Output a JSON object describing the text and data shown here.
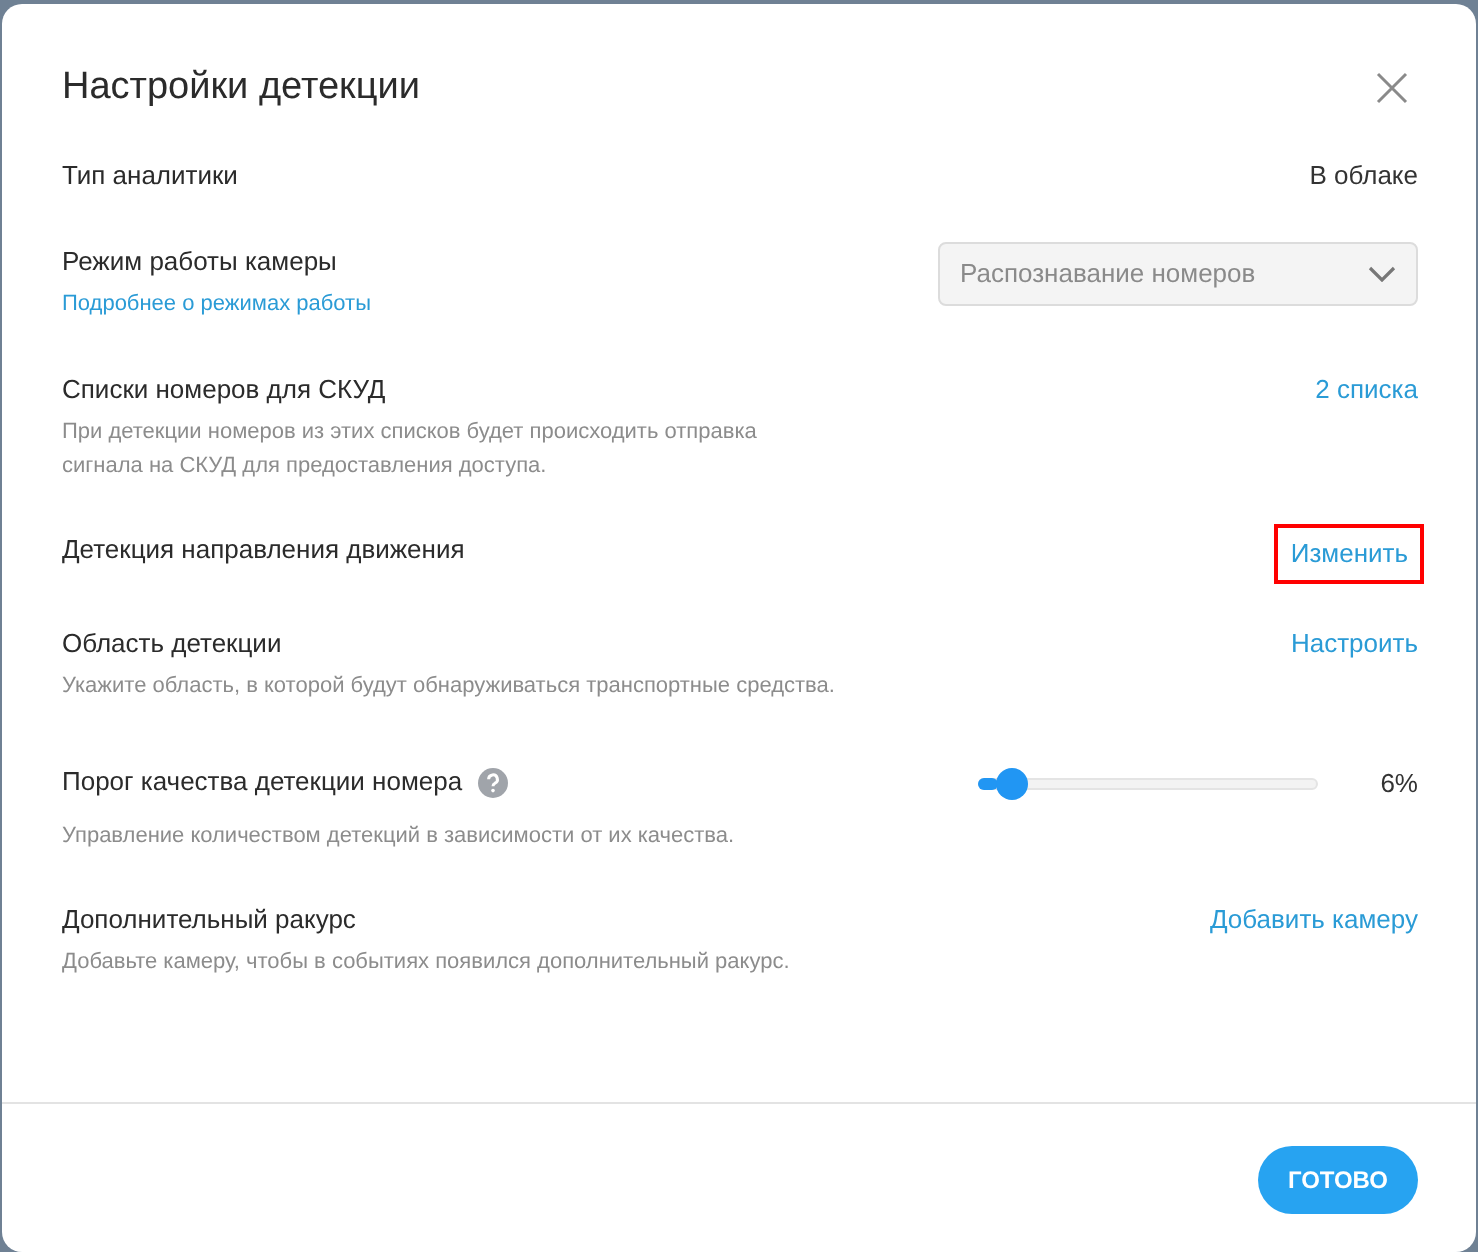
{
  "dialog": {
    "title": "Настройки детекции"
  },
  "settings": [
    {
      "kind": "text",
      "label": "Тип аналитики",
      "value": "В облаке"
    },
    {
      "kind": "select",
      "label": "Режим работы камеры",
      "link": "Подробнее о режимах работы",
      "value": "Распознавание номеров",
      "disabled": true
    },
    {
      "kind": "action",
      "label": "Списки номеров для СКУД",
      "description": "При детекции номеров из этих списков будет происходить отправка сигнала на СКУД для предоставления доступа.",
      "action": "2 списка",
      "highlighted": false
    },
    {
      "kind": "action",
      "label": "Детекция направления движения",
      "action": "Изменить",
      "highlighted": true
    },
    {
      "kind": "action",
      "label": "Область детекции",
      "description": "Укажите область, в которой будут обнаруживаться транспортные средства.",
      "action": "Настроить",
      "highlighted": false
    },
    {
      "kind": "slider",
      "label": "Порог качества детекции номера",
      "help": true,
      "description": "Управление количеством детекций в зависимости от их качества.",
      "level": 0.06,
      "reading": "6%"
    },
    {
      "kind": "action",
      "label": "Дополнительный ракурс",
      "description": "Добавьте камеру, чтобы в событиях появился дополнительный ракурс.",
      "action": "Добавить камеру",
      "highlighted": false
    }
  ],
  "buttons": [
    {
      "label": "ГОТОВО"
    }
  ]
}
